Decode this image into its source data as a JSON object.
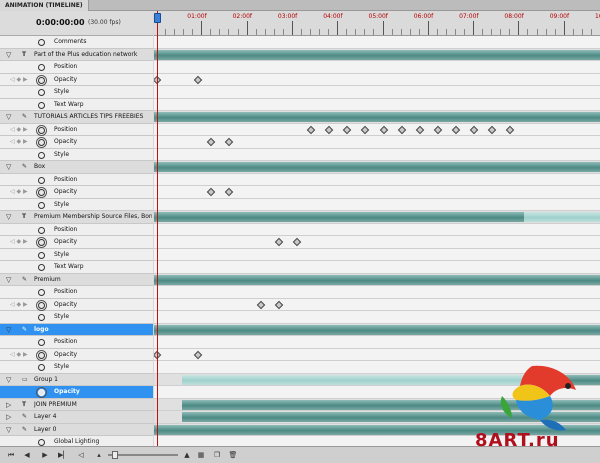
{
  "panel": {
    "tab_label": "ANIMATION (TIMELINE)"
  },
  "timecode": {
    "value": "0:00:00:00",
    "fps": "(30.00 fps)"
  },
  "ruler": {
    "labels": [
      "01:00f",
      "02:00f",
      "03:00f",
      "04:00f",
      "05:00f",
      "06:00f",
      "07:00f",
      "08:00f",
      "09:00f",
      "10:00f"
    ]
  },
  "rows": [
    {
      "kind": "prop",
      "label": "Comments",
      "icon": "stopwatch-icon",
      "keyframes": []
    },
    {
      "kind": "layer",
      "label": "Part of the Plus education network",
      "icon": "type-layer-icon",
      "bar": "full",
      "keyframes": []
    },
    {
      "kind": "prop",
      "label": "Position",
      "icon": "stopwatch-icon",
      "keyframes": []
    },
    {
      "kind": "prop",
      "label": "Opacity",
      "icon": "stopwatch-icon",
      "animated": true,
      "keyframes": [
        0.0,
        0.9
      ]
    },
    {
      "kind": "prop",
      "label": "Style",
      "icon": "stopwatch-icon",
      "keyframes": []
    },
    {
      "kind": "prop",
      "label": "Text Warp",
      "icon": "stopwatch-icon",
      "keyframes": []
    },
    {
      "kind": "layer",
      "label": "TUTORIALS  ARTICLES  TIPS  FREEBIES",
      "icon": "brush-icon",
      "bar": "full",
      "keyframes": []
    },
    {
      "kind": "prop",
      "label": "Position",
      "icon": "stopwatch-icon",
      "animated": true,
      "keyframes": [
        3.4,
        3.8,
        4.2,
        4.6,
        5.0,
        5.4,
        5.8,
        6.2,
        6.6,
        7.0,
        7.4,
        7.8
      ]
    },
    {
      "kind": "prop",
      "label": "Opacity",
      "icon": "stopwatch-icon",
      "animated": true,
      "keyframes": [
        1.2,
        1.6
      ]
    },
    {
      "kind": "prop",
      "label": "Style",
      "icon": "stopwatch-icon",
      "keyframes": []
    },
    {
      "kind": "layer",
      "label": "Box",
      "icon": "brush-icon",
      "bar": "full",
      "keyframes": []
    },
    {
      "kind": "prop",
      "label": "Position",
      "icon": "stopwatch-icon",
      "keyframes": []
    },
    {
      "kind": "prop",
      "label": "Opacity",
      "icon": "stopwatch-icon",
      "animated": true,
      "keyframes": [
        1.2,
        1.6
      ]
    },
    {
      "kind": "prop",
      "label": "Style",
      "icon": "stopwatch-icon",
      "keyframes": []
    },
    {
      "kind": "layer",
      "label": "Premium Membership Source Files, Bonu",
      "icon": "type-layer-icon",
      "bar": "split",
      "keyframes": []
    },
    {
      "kind": "prop",
      "label": "Position",
      "icon": "stopwatch-icon",
      "keyframes": []
    },
    {
      "kind": "prop",
      "label": "Opacity",
      "icon": "stopwatch-icon",
      "animated": true,
      "keyframes": [
        2.7,
        3.1
      ]
    },
    {
      "kind": "prop",
      "label": "Style",
      "icon": "stopwatch-icon",
      "keyframes": []
    },
    {
      "kind": "prop",
      "label": "Text Warp",
      "icon": "stopwatch-icon",
      "keyframes": []
    },
    {
      "kind": "layer",
      "label": "Premium",
      "icon": "brush-icon",
      "bar": "full",
      "keyframes": []
    },
    {
      "kind": "prop",
      "label": "Position",
      "icon": "stopwatch-icon",
      "keyframes": []
    },
    {
      "kind": "prop",
      "label": "Opacity",
      "icon": "stopwatch-icon",
      "animated": true,
      "keyframes": [
        2.3,
        2.7
      ]
    },
    {
      "kind": "prop",
      "label": "Style",
      "icon": "stopwatch-icon",
      "keyframes": []
    },
    {
      "kind": "layer",
      "label": "logo",
      "icon": "brush-icon",
      "bar": "full",
      "selected": true,
      "keyframes": []
    },
    {
      "kind": "prop",
      "label": "Position",
      "icon": "stopwatch-icon",
      "keyframes": []
    },
    {
      "kind": "prop",
      "label": "Opacity",
      "icon": "stopwatch-icon",
      "animated": true,
      "keyframes": [
        0.0,
        0.9
      ]
    },
    {
      "kind": "prop",
      "label": "Style",
      "icon": "stopwatch-icon",
      "keyframes": []
    },
    {
      "kind": "layer",
      "label": "Group 1",
      "icon": "folder-icon",
      "bar": "group",
      "keyframes": []
    },
    {
      "kind": "prop",
      "label": "Opacity",
      "icon": "stopwatch-icon",
      "selected": true,
      "keyframes": []
    },
    {
      "kind": "layer",
      "label": "JOIN PREMIUM",
      "icon": "type-layer-icon",
      "bar": "late",
      "keyframes": []
    },
    {
      "kind": "layer",
      "label": "Layer 4",
      "icon": "brush-icon",
      "bar": "late",
      "keyframes": []
    },
    {
      "kind": "layer",
      "label": "Layer 0",
      "icon": "brush-icon",
      "bar": "full",
      "keyframes": []
    },
    {
      "kind": "prop",
      "label": "Global Lighting",
      "icon": "stopwatch-icon",
      "keyframes": []
    }
  ],
  "bottom_bar": {
    "icons": [
      "first-frame-icon",
      "prev-frame-icon",
      "play-icon",
      "next-frame-icon",
      "audio-icon",
      "zoom-out-icon",
      "zoom-in-icon",
      "convert-frames-icon",
      "duplicate-icon",
      "delete-icon"
    ]
  },
  "watermark": {
    "text": "8ART.ru"
  },
  "colors": {
    "bar": "#5f9792",
    "bar_light": "#a8d6d1",
    "selection": "#2f92f0",
    "playhead": "#c01010",
    "ruler_label": "#b30000"
  }
}
